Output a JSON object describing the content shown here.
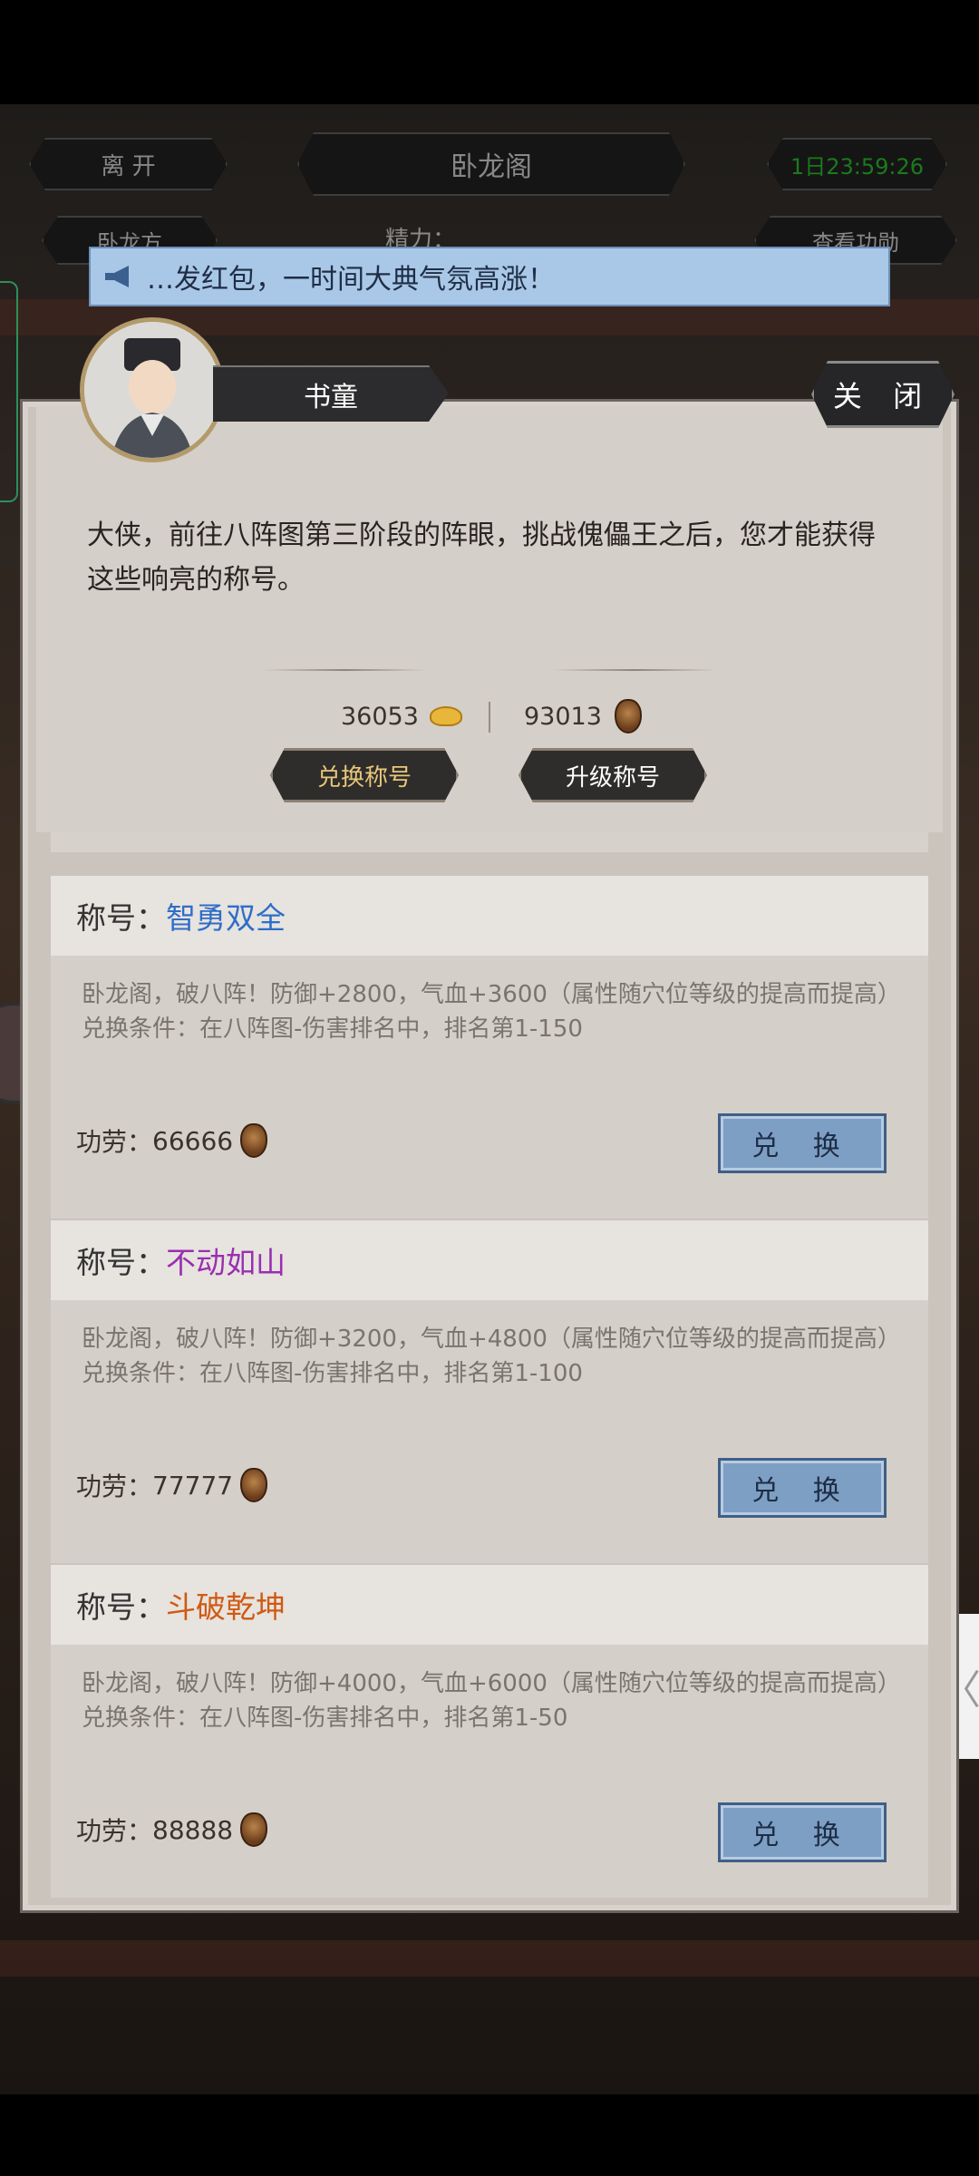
{
  "header": {
    "leave_label": "离 开",
    "title": "卧龙阁",
    "timer": "1日23:59:26",
    "left_sub_label": "卧龙方",
    "energy_label": "精力：",
    "right_sub_label": "查看功勋"
  },
  "notice": {
    "text": "…发红包，一时间大典气氛高涨！"
  },
  "dialog": {
    "npc_name": "书童",
    "close_label": "关 闭",
    "description": "大侠，前往八阵图第三阶段的阵眼，挑战傀儡王之后，您才能获得这些响亮的称号。",
    "gold": "36053",
    "merit": "93013",
    "exchange_title_label": "兑换称号",
    "upgrade_title_label": "升级称号"
  },
  "titles": [
    {
      "label": "称号：",
      "name": "智勇双全",
      "effect": "卧龙阁，破八阵！防御+2800，气血+3600（属性随穴位等级的提高而提高）",
      "condition": "兑换条件：在八阵图-伤害排名中，排名第1-150",
      "cost_label": "功劳：",
      "cost": "66666",
      "button": "兑 换",
      "color": "#2f6ec8"
    },
    {
      "label": "称号：",
      "name": "不动如山",
      "effect": "卧龙阁，破八阵！防御+3200，气血+4800（属性随穴位等级的提高而提高）",
      "condition": "兑换条件：在八阵图-伤害排名中，排名第1-100",
      "cost_label": "功劳：",
      "cost": "77777",
      "button": "兑 换",
      "color": "#9a2fb0"
    },
    {
      "label": "称号：",
      "name": "斗破乾坤",
      "effect": "卧龙阁，破八阵！防御+4000，气血+6000（属性随穴位等级的提高而提高）",
      "condition": "兑换条件：在八阵图-伤害排名中，排名第1-50",
      "cost_label": "功劳：",
      "cost": "88888",
      "button": "兑 换",
      "color": "#cf5a12"
    }
  ],
  "icons": {
    "notice": "megaphone-icon",
    "gold": "gold-ingot-icon",
    "merit": "merit-medal-icon",
    "side": "back-chevron-icon"
  },
  "side_tab_glyph": "〈"
}
